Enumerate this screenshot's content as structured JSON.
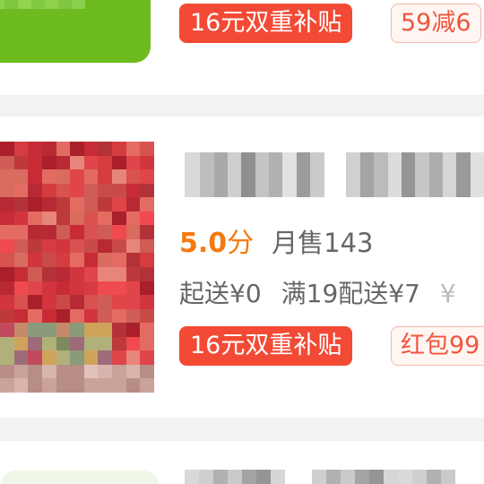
{
  "top_card": {
    "tag_subsidy": "16元双重补贴",
    "tag_discount": "59减6"
  },
  "shop_card": {
    "score_value": "5.0",
    "score_unit": "分",
    "monthly_sales": "月售143",
    "min_order": "起送¥0",
    "delivery_fee": "满19配送¥7",
    "delivery_extra": "¥",
    "tag_subsidy": "16元双重补贴",
    "tag_redpacket": "红包99"
  },
  "colors": {
    "accent_orange": "#f57a10",
    "tag_red": "#f24a35",
    "green_button": "#6dbb1f",
    "separator": "#f2f2f2"
  }
}
